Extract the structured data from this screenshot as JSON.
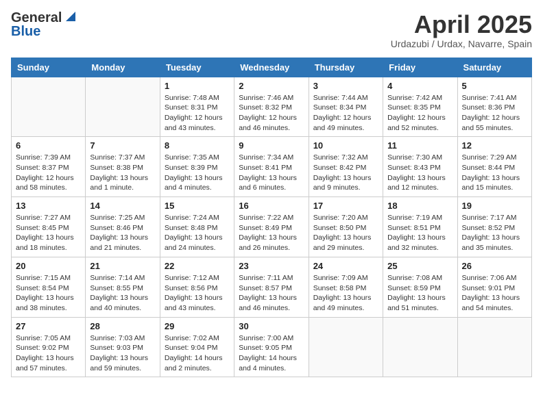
{
  "header": {
    "logo_general": "General",
    "logo_blue": "Blue",
    "month": "April 2025",
    "location": "Urdazubi / Urdax, Navarre, Spain"
  },
  "weekdays": [
    "Sunday",
    "Monday",
    "Tuesday",
    "Wednesday",
    "Thursday",
    "Friday",
    "Saturday"
  ],
  "weeks": [
    [
      {
        "day": "",
        "info": ""
      },
      {
        "day": "",
        "info": ""
      },
      {
        "day": "1",
        "info": "Sunrise: 7:48 AM\nSunset: 8:31 PM\nDaylight: 12 hours and 43 minutes."
      },
      {
        "day": "2",
        "info": "Sunrise: 7:46 AM\nSunset: 8:32 PM\nDaylight: 12 hours and 46 minutes."
      },
      {
        "day": "3",
        "info": "Sunrise: 7:44 AM\nSunset: 8:34 PM\nDaylight: 12 hours and 49 minutes."
      },
      {
        "day": "4",
        "info": "Sunrise: 7:42 AM\nSunset: 8:35 PM\nDaylight: 12 hours and 52 minutes."
      },
      {
        "day": "5",
        "info": "Sunrise: 7:41 AM\nSunset: 8:36 PM\nDaylight: 12 hours and 55 minutes."
      }
    ],
    [
      {
        "day": "6",
        "info": "Sunrise: 7:39 AM\nSunset: 8:37 PM\nDaylight: 12 hours and 58 minutes."
      },
      {
        "day": "7",
        "info": "Sunrise: 7:37 AM\nSunset: 8:38 PM\nDaylight: 13 hours and 1 minute."
      },
      {
        "day": "8",
        "info": "Sunrise: 7:35 AM\nSunset: 8:39 PM\nDaylight: 13 hours and 4 minutes."
      },
      {
        "day": "9",
        "info": "Sunrise: 7:34 AM\nSunset: 8:41 PM\nDaylight: 13 hours and 6 minutes."
      },
      {
        "day": "10",
        "info": "Sunrise: 7:32 AM\nSunset: 8:42 PM\nDaylight: 13 hours and 9 minutes."
      },
      {
        "day": "11",
        "info": "Sunrise: 7:30 AM\nSunset: 8:43 PM\nDaylight: 13 hours and 12 minutes."
      },
      {
        "day": "12",
        "info": "Sunrise: 7:29 AM\nSunset: 8:44 PM\nDaylight: 13 hours and 15 minutes."
      }
    ],
    [
      {
        "day": "13",
        "info": "Sunrise: 7:27 AM\nSunset: 8:45 PM\nDaylight: 13 hours and 18 minutes."
      },
      {
        "day": "14",
        "info": "Sunrise: 7:25 AM\nSunset: 8:46 PM\nDaylight: 13 hours and 21 minutes."
      },
      {
        "day": "15",
        "info": "Sunrise: 7:24 AM\nSunset: 8:48 PM\nDaylight: 13 hours and 24 minutes."
      },
      {
        "day": "16",
        "info": "Sunrise: 7:22 AM\nSunset: 8:49 PM\nDaylight: 13 hours and 26 minutes."
      },
      {
        "day": "17",
        "info": "Sunrise: 7:20 AM\nSunset: 8:50 PM\nDaylight: 13 hours and 29 minutes."
      },
      {
        "day": "18",
        "info": "Sunrise: 7:19 AM\nSunset: 8:51 PM\nDaylight: 13 hours and 32 minutes."
      },
      {
        "day": "19",
        "info": "Sunrise: 7:17 AM\nSunset: 8:52 PM\nDaylight: 13 hours and 35 minutes."
      }
    ],
    [
      {
        "day": "20",
        "info": "Sunrise: 7:15 AM\nSunset: 8:54 PM\nDaylight: 13 hours and 38 minutes."
      },
      {
        "day": "21",
        "info": "Sunrise: 7:14 AM\nSunset: 8:55 PM\nDaylight: 13 hours and 40 minutes."
      },
      {
        "day": "22",
        "info": "Sunrise: 7:12 AM\nSunset: 8:56 PM\nDaylight: 13 hours and 43 minutes."
      },
      {
        "day": "23",
        "info": "Sunrise: 7:11 AM\nSunset: 8:57 PM\nDaylight: 13 hours and 46 minutes."
      },
      {
        "day": "24",
        "info": "Sunrise: 7:09 AM\nSunset: 8:58 PM\nDaylight: 13 hours and 49 minutes."
      },
      {
        "day": "25",
        "info": "Sunrise: 7:08 AM\nSunset: 8:59 PM\nDaylight: 13 hours and 51 minutes."
      },
      {
        "day": "26",
        "info": "Sunrise: 7:06 AM\nSunset: 9:01 PM\nDaylight: 13 hours and 54 minutes."
      }
    ],
    [
      {
        "day": "27",
        "info": "Sunrise: 7:05 AM\nSunset: 9:02 PM\nDaylight: 13 hours and 57 minutes."
      },
      {
        "day": "28",
        "info": "Sunrise: 7:03 AM\nSunset: 9:03 PM\nDaylight: 13 hours and 59 minutes."
      },
      {
        "day": "29",
        "info": "Sunrise: 7:02 AM\nSunset: 9:04 PM\nDaylight: 14 hours and 2 minutes."
      },
      {
        "day": "30",
        "info": "Sunrise: 7:00 AM\nSunset: 9:05 PM\nDaylight: 14 hours and 4 minutes."
      },
      {
        "day": "",
        "info": ""
      },
      {
        "day": "",
        "info": ""
      },
      {
        "day": "",
        "info": ""
      }
    ]
  ]
}
